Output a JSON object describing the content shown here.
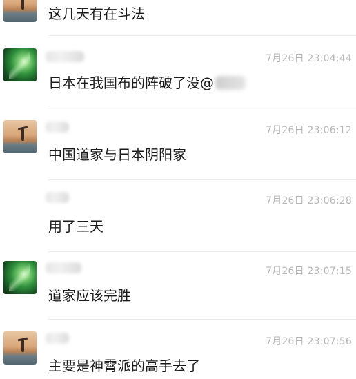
{
  "messages": [
    {
      "avatar": "partial",
      "name": "",
      "time": "",
      "text": "这几天有在斗法"
    },
    {
      "avatar": "green-leaf",
      "name": "",
      "time": "7月26日 23:04:44",
      "text": "日本在我国布的阵破了没@"
    },
    {
      "avatar": "sunset-person",
      "name": "",
      "time": "7月26日 23:06:12",
      "text": "中国道家与日本阴阳家"
    },
    {
      "avatar": "none",
      "name": "",
      "time": "7月26日 23:06:28",
      "text": "用了三天"
    },
    {
      "avatar": "green-leaf",
      "name": "",
      "time": "7月26日 23:07:15",
      "text": "道家应该完胜"
    },
    {
      "avatar": "sunset-person",
      "name": "",
      "time": "7月26日 23:07:56",
      "text": "主要是神霄派的高手去了"
    }
  ],
  "colors": {
    "text": "#1b1b1b",
    "timestamp": "#b7b7b7",
    "divider": "#ececec"
  }
}
